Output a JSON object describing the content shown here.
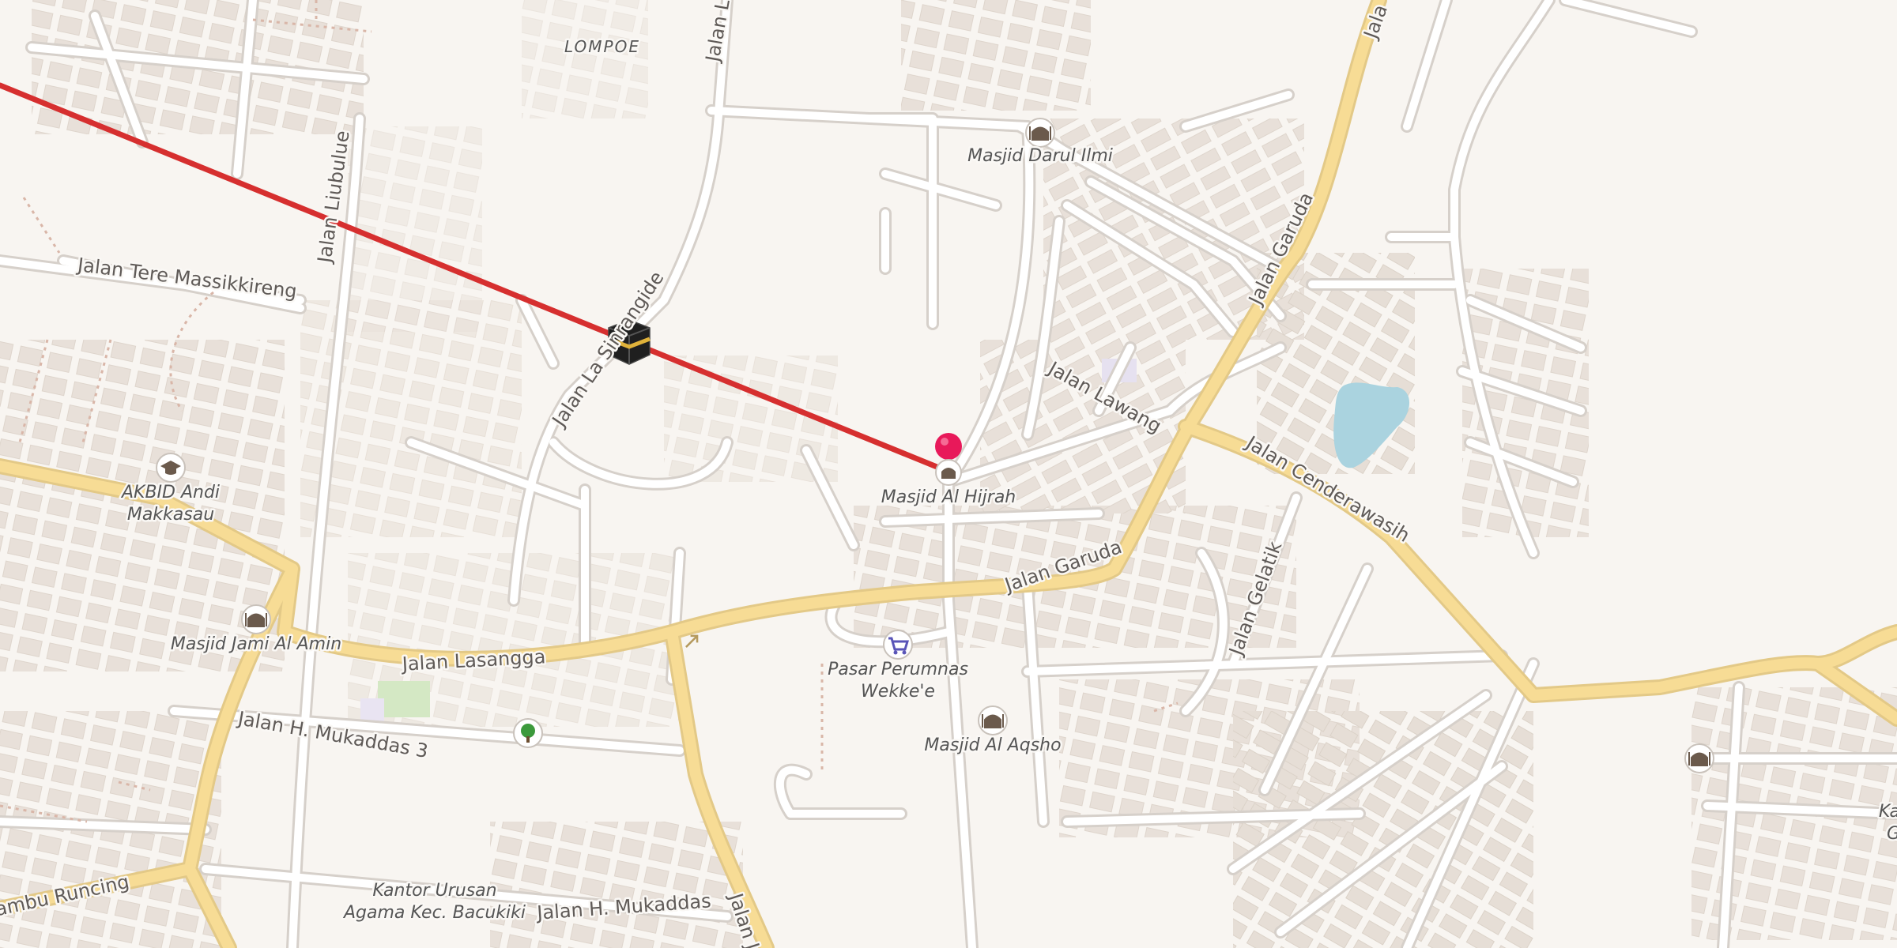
{
  "map": {
    "area_label": "LOMPOE",
    "roads": {
      "jalan_lasangga": "Jalan Lasangga",
      "jalan_garuda_main": "Jalan Garuda",
      "jalan_garuda_north": "Jalan Garuda",
      "jalan_garuda_edge": "Jala",
      "jalan_cenderawasih": "Jalan Cenderawasih",
      "jalan_lawang": "Jalan Lawang",
      "jalan_gelatik": "Jalan Gelatik",
      "jalan_tere": "Jalan Tere Massikkireng",
      "jalan_liubulue": "Jalan Liubulue",
      "jalan_lasinrangide": "Jalan La Sinrangide",
      "jalan_mukaddas3": "Jalan H. Mukaddas 3",
      "jalan_mukaddas": "Jalan H. Mukaddas",
      "jalan_bambu": "Jalan Bambu Runcing",
      "jalan_top": "Jalan L",
      "jalan_bottom": "Jalan Je"
    },
    "pois": {
      "masjid_darul_ilmi": "Masjid Darul Ilmi",
      "masjid_al_hijrah": "Masjid Al Hijrah",
      "akbid_line1": "AKBID Andi",
      "akbid_line2": "Makkasau",
      "masjid_jami": "Masjid Jami Al Amin",
      "pasar_line1": "Pasar Perumnas",
      "pasar_line2": "Wekke'e",
      "masjid_al_aqsho": "Masjid Al Aqsho",
      "kantor_line1": "Kantor Urusan",
      "kantor_line2": "Agama Kec. Bacukiki",
      "edge_k": "Ka",
      "edge_g": "G"
    },
    "qibla_line_color": "#d62f2f",
    "marker_color": "#e8195a",
    "icons": [
      "kaaba-icon",
      "location-pin-icon",
      "mosque-icon",
      "graduation-cap-icon",
      "shopping-cart-icon",
      "tree-icon"
    ]
  }
}
